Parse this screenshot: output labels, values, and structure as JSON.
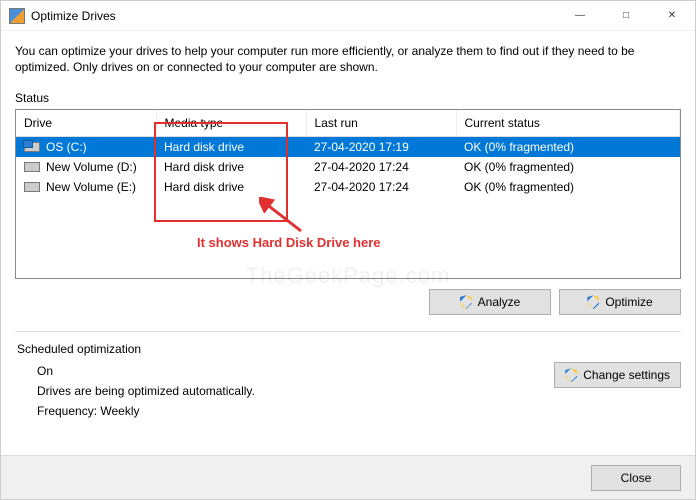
{
  "window": {
    "title": "Optimize Drives"
  },
  "intro": "You can optimize your drives to help your computer run more efficiently, or analyze them to find out if they need to be optimized. Only drives on or connected to your computer are shown.",
  "status": {
    "label": "Status",
    "columns": {
      "drive": "Drive",
      "media": "Media type",
      "last": "Last run",
      "current": "Current status"
    },
    "rows": [
      {
        "drive": "OS (C:)",
        "media": "Hard disk drive",
        "last": "27-04-2020 17:19",
        "current": "OK (0% fragmented)",
        "selected": true,
        "os": true
      },
      {
        "drive": "New Volume (D:)",
        "media": "Hard disk drive",
        "last": "27-04-2020 17:24",
        "current": "OK (0% fragmented)",
        "selected": false,
        "os": false
      },
      {
        "drive": "New Volume (E:)",
        "media": "Hard disk drive",
        "last": "27-04-2020 17:24",
        "current": "OK (0% fragmented)",
        "selected": false,
        "os": false
      }
    ]
  },
  "buttons": {
    "analyze": "Analyze",
    "optimize": "Optimize",
    "change": "Change settings",
    "close": "Close"
  },
  "scheduled": {
    "label": "Scheduled optimization",
    "state": "On",
    "desc": "Drives are being optimized automatically.",
    "freq_label": "Frequency:",
    "freq_value": "Weekly"
  },
  "annotation": {
    "text": "It shows Hard Disk Drive here"
  },
  "watermark": "TheGeekPage.com"
}
